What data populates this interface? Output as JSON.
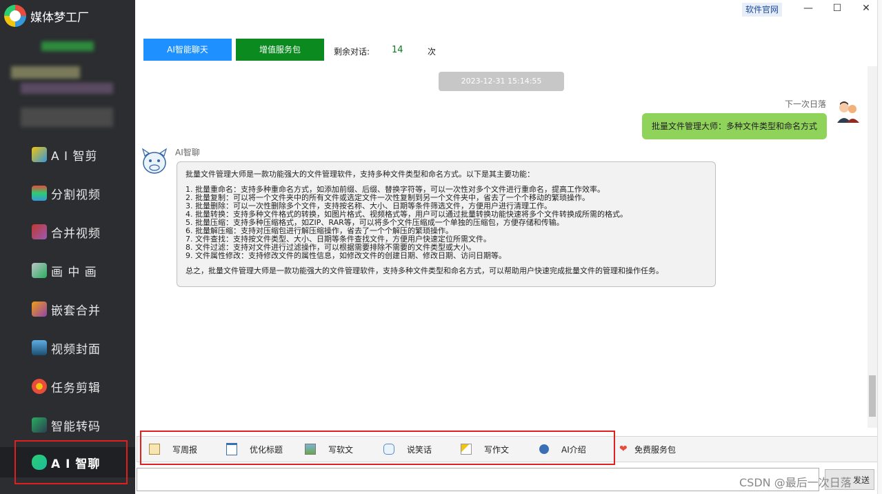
{
  "app": {
    "title": "媒体梦工厂",
    "site_link": "软件官网"
  },
  "window": {
    "minimize": "—",
    "maximize": "☐",
    "close": "✕"
  },
  "sidebar": {
    "items": [
      {
        "label": "A I 智剪",
        "icon": "ai-cut-icon"
      },
      {
        "label": "分割视频",
        "icon": "split-video-icon"
      },
      {
        "label": "合并视频",
        "icon": "merge-video-icon"
      },
      {
        "label": "画 中 画",
        "icon": "picture-in-picture-icon"
      },
      {
        "label": "嵌套合并",
        "icon": "nested-merge-icon"
      },
      {
        "label": "视频封面",
        "icon": "video-cover-icon"
      },
      {
        "label": "任务剪辑",
        "icon": "task-edit-icon"
      },
      {
        "label": "智能转码",
        "icon": "smart-transcode-icon"
      },
      {
        "label": "A I 智聊",
        "icon": "ai-chat-icon"
      }
    ]
  },
  "top": {
    "ai_chat_button": "AI智能聊天",
    "vip_button": "增值服务包",
    "remain_label": "剩余对话:",
    "remain_count": "14",
    "remain_unit": "次"
  },
  "chat": {
    "timestamp": "2023-12-31 15:14:55",
    "user_name": "下一次日落",
    "user_message": "批量文件管理大师：多种文件类型和命名方式",
    "bot_name": "AI智聊",
    "bot_intro": "批量文件管理大师是一款功能强大的文件管理软件，支持多种文件类型和命名方式。以下是其主要功能：",
    "bot_items": [
      "1. 批量重命名：支持多种重命名方式，如添加前缀、后缀、替换字符等，可以一次性对多个文件进行重命名，提高工作效率。",
      "2. 批量复制：可以将一个文件夹中的所有文件或选定文件一次性复制到另一个文件夹中，省去了一个个移动的繁琐操作。",
      "3. 批量删除：可以一次性删除多个文件，支持按名称、大小、日期等条件筛选文件，方便用户进行清理工作。",
      "4. 批量转换：支持多种文件格式的转换，如图片格式、视频格式等，用户可以通过批量转换功能快速将多个文件转换成所需的格式。",
      "5. 批量压缩：支持多种压缩格式，如ZIP、RAR等，可以将多个文件压缩成一个单独的压缩包，方便存储和传输。",
      "6. 批量解压缩：支持对压缩包进行解压缩操作，省去了一个个解压的繁琐操作。",
      "7. 文件查找：支持按文件类型、大小、日期等条件查找文件，方便用户快速定位所需文件。",
      "8. 文件过滤：支持对文件进行过滤操作，可以根据需要排除不需要的文件类型或大小。",
      "9. 文件属性修改：支持修改文件的属性信息，如修改文件的创建日期、修改日期、访问日期等。"
    ],
    "bot_summary": "总之，批量文件管理大师是一款功能强大的文件管理软件，支持多种文件类型和命名方式，可以帮助用户快速完成批量文件的管理和操作任务。"
  },
  "toolbar": {
    "items": [
      {
        "label": "写周报",
        "icon": "weekly-report-icon"
      },
      {
        "label": "优化标题",
        "icon": "optimize-title-icon"
      },
      {
        "label": "写软文",
        "icon": "write-article-icon"
      },
      {
        "label": "说笑话",
        "icon": "joke-icon"
      },
      {
        "label": "写作文",
        "icon": "essay-icon"
      },
      {
        "label": "AI介绍",
        "icon": "info-icon"
      }
    ],
    "free_pack": "免费服务包",
    "send": "发送"
  },
  "watermark": "CSDN @最后一次日落",
  "colors": {
    "sidebar": "#2b2d30",
    "ai_button": "#1e90ff",
    "vip_button": "#0a8a1f",
    "user_bubble": "#8fd35a",
    "highlight": "#e02020"
  }
}
